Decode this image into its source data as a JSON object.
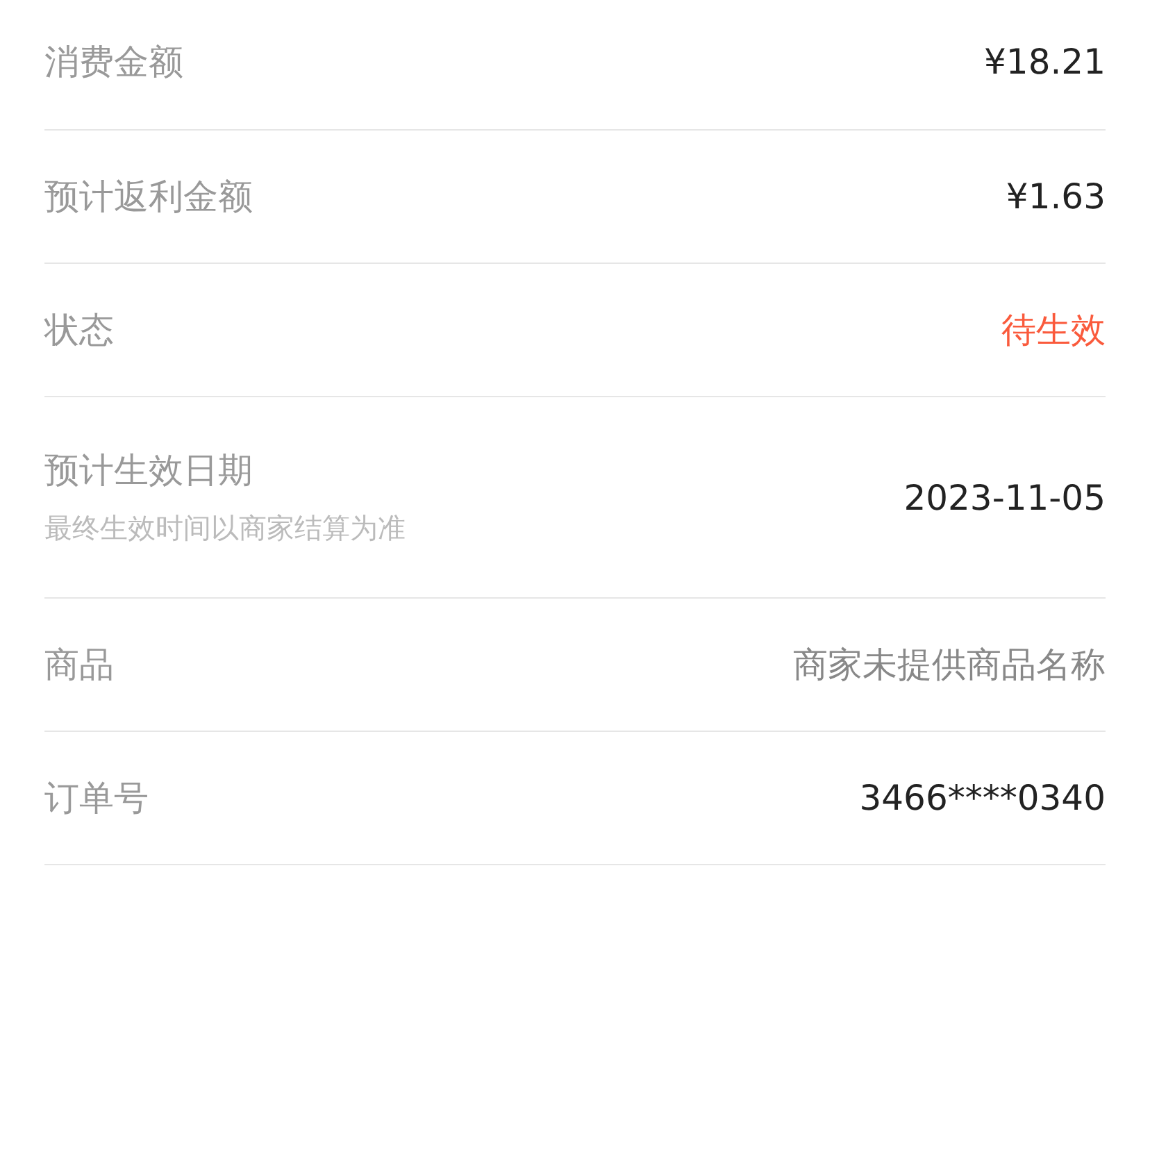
{
  "rows": [
    {
      "label": "消费金额",
      "value": "¥18.21",
      "color": "#222222"
    },
    {
      "label": "预计返利金额",
      "value": "¥1.63",
      "color": "#222222"
    },
    {
      "label": "状态",
      "value": "待生效",
      "color": "#fa5a3c"
    },
    {
      "label": "预计生效日期",
      "note": "最终生效时间以商家结算为准",
      "value": "2023-11-05",
      "color": "#222222"
    },
    {
      "label": "商品",
      "value": "商家未提供商品名称",
      "color": "#888888"
    },
    {
      "label": "订单号",
      "value": "3466****0340",
      "color": "#222222"
    }
  ]
}
